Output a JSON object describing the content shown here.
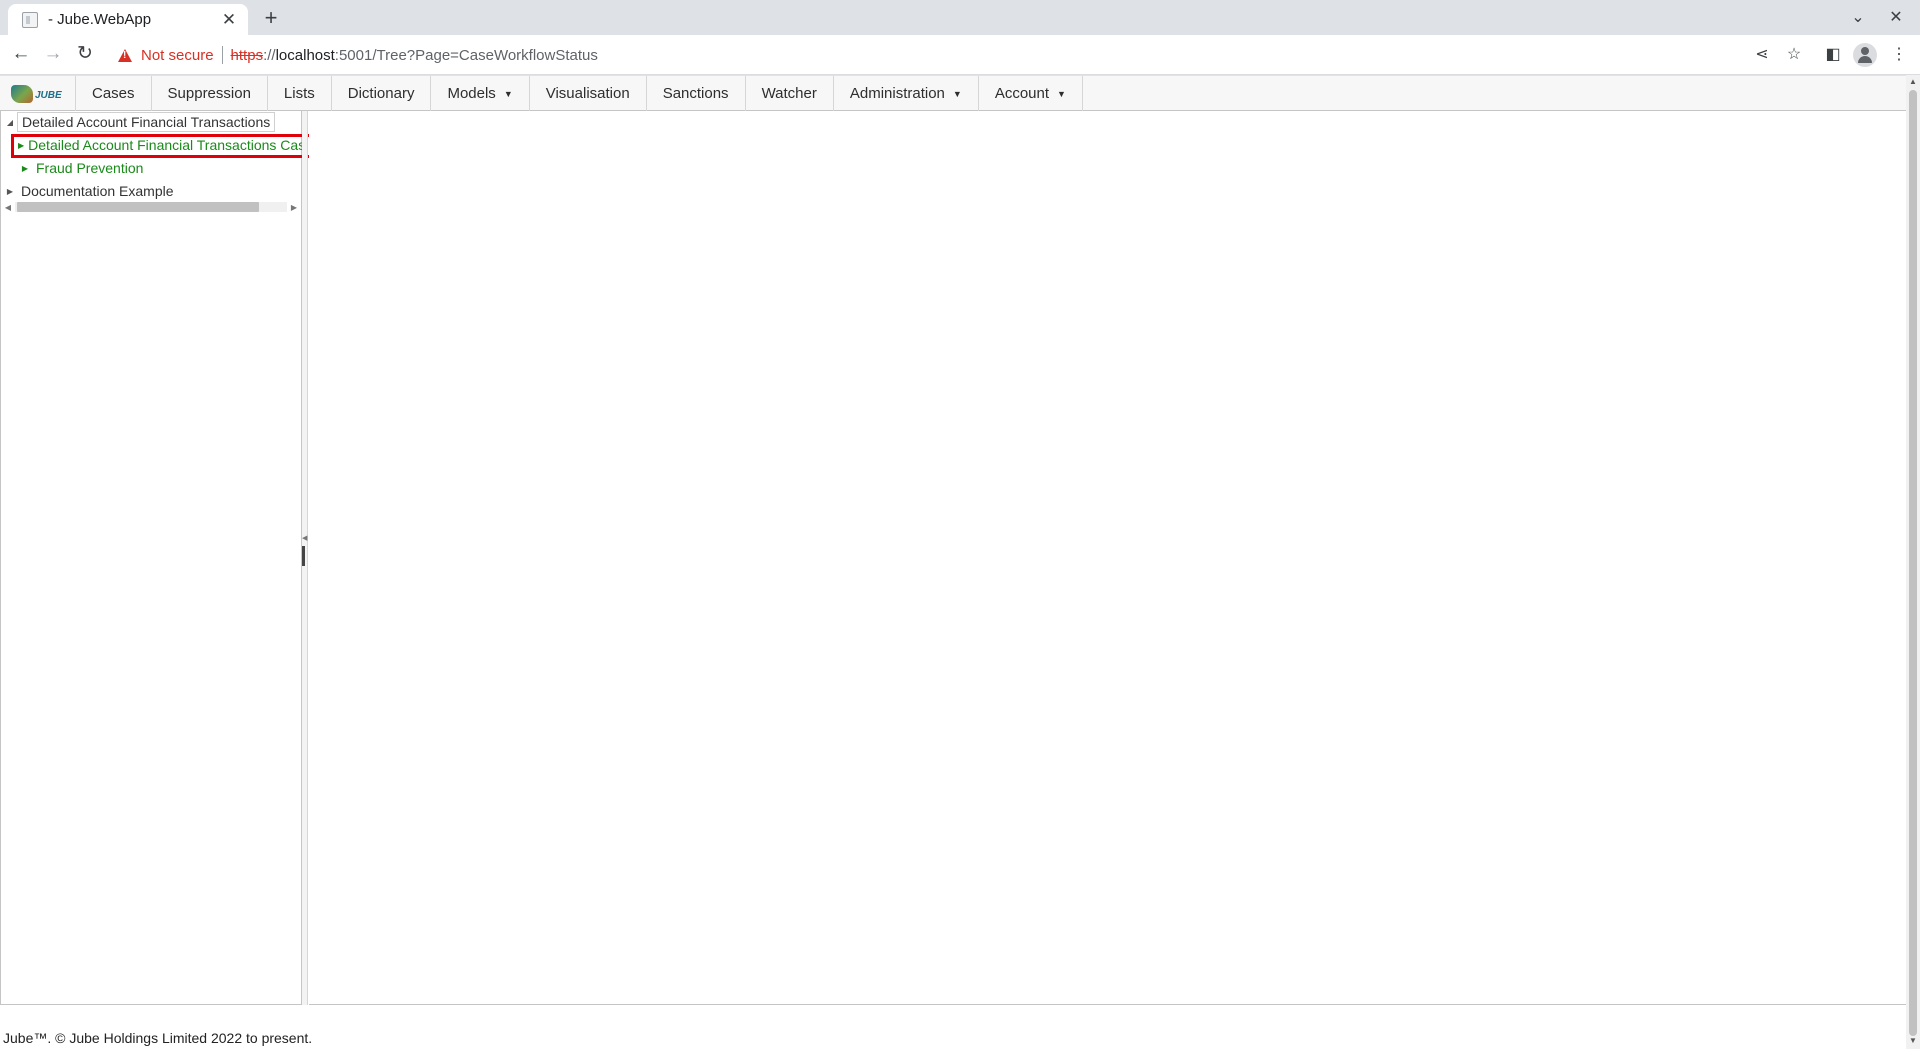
{
  "browser": {
    "tab_title": "- Jube.WebApp",
    "tab_close": "✕",
    "new_tab": "+",
    "security_label": "Not secure",
    "url_protocol": "https",
    "url_sep": "://",
    "url_host": "localhost",
    "url_rest": ":5001/Tree?Page=CaseWorkflowStatus"
  },
  "menu": {
    "logo_text": "JUBE",
    "items": [
      {
        "label": "Cases"
      },
      {
        "label": "Suppression"
      },
      {
        "label": "Lists"
      },
      {
        "label": "Dictionary"
      },
      {
        "label": "Models",
        "dropdown": true
      },
      {
        "label": "Visualisation"
      },
      {
        "label": "Sanctions"
      },
      {
        "label": "Watcher"
      },
      {
        "label": "Administration",
        "dropdown": true
      },
      {
        "label": "Account",
        "dropdown": true
      }
    ]
  },
  "tree": {
    "nodes": [
      {
        "label": "Detailed Account Financial Transactions",
        "expanded": true,
        "children": [
          {
            "label": "Detailed Account Financial Transactions Cases Workflow"
          },
          {
            "label": "Fraud Prevention"
          }
        ]
      },
      {
        "label": "Documentation Example",
        "expanded": false
      }
    ]
  },
  "colors": {
    "child_node_text": "#1a8a1a",
    "highlight_border": "#e0000a",
    "not_secure": "#d93025"
  },
  "footer": {
    "text": "Jube™. © Jube Holdings Limited 2022 to present."
  }
}
